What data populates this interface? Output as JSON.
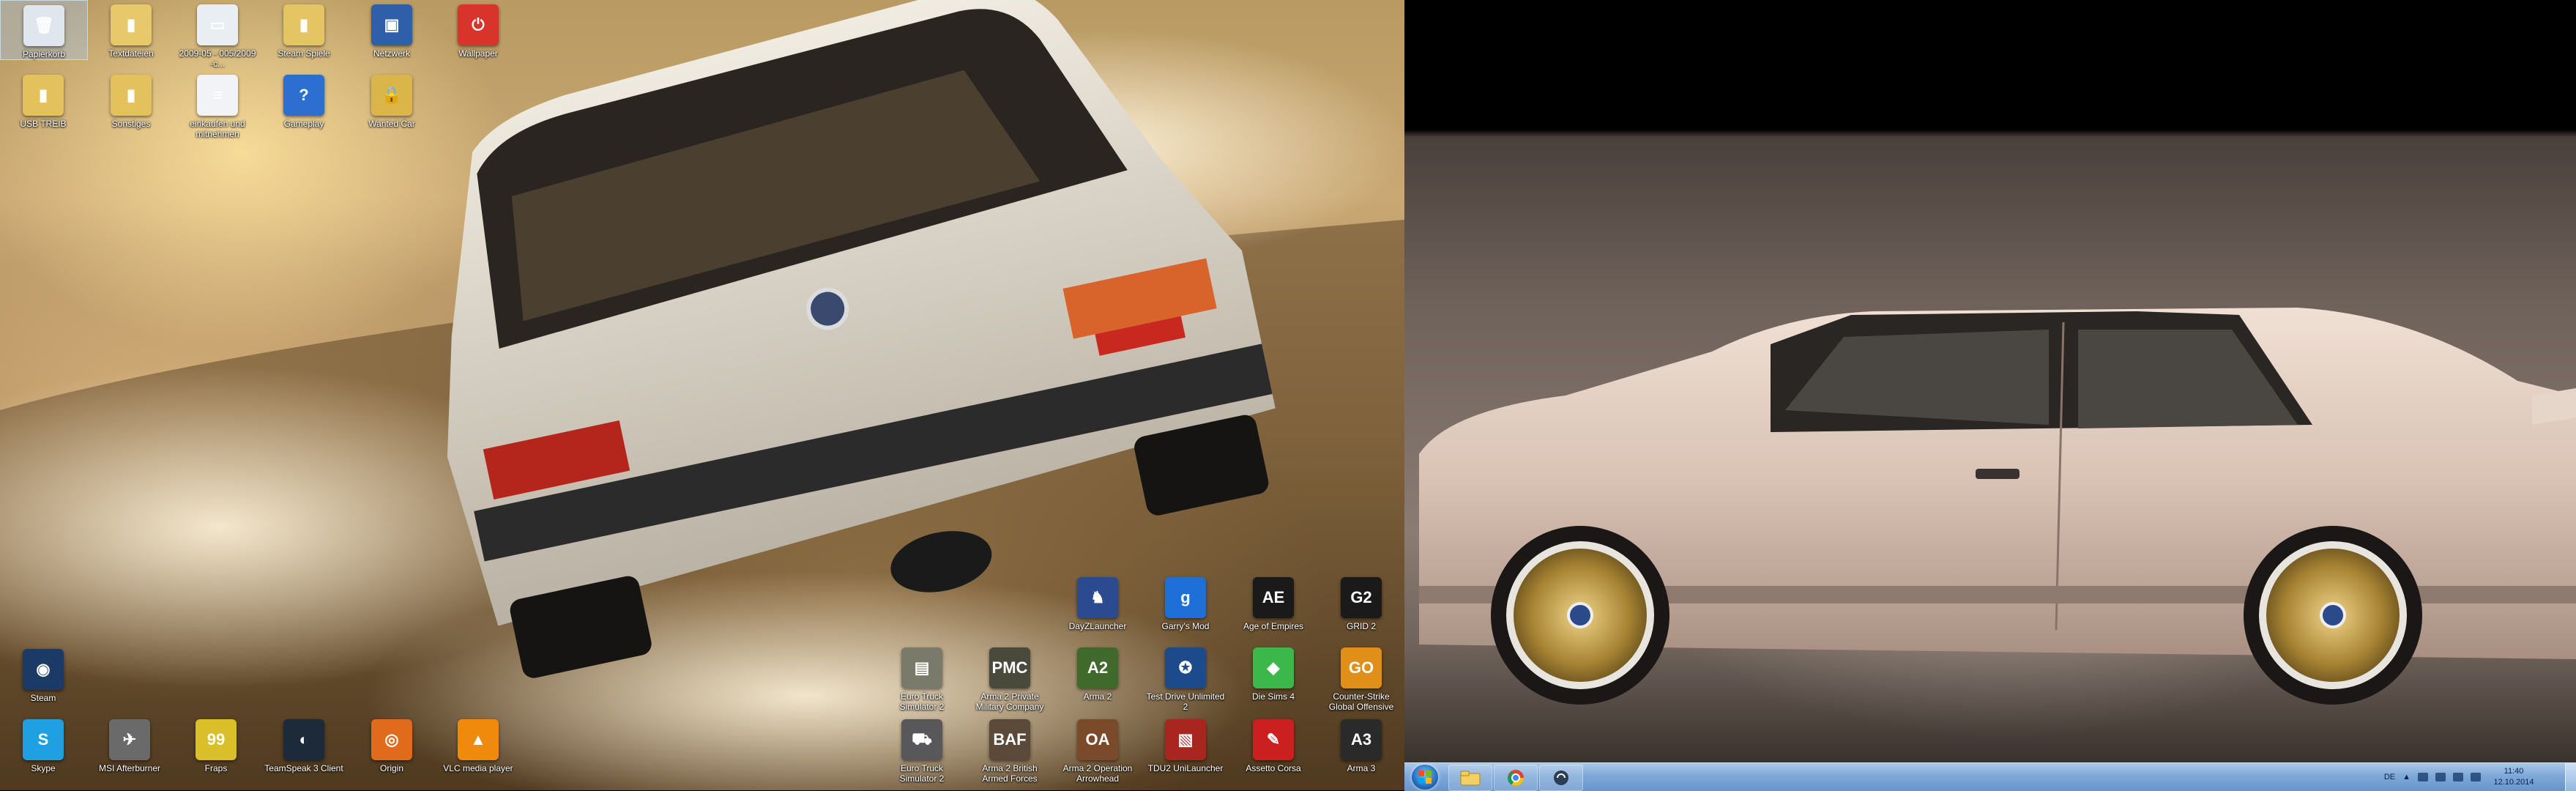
{
  "desktop_top": [
    {
      "name": "recycle-bin-icon",
      "label": "Papierkorb",
      "color": "#dfe6ee",
      "glyph": "🗑",
      "selected": true
    },
    {
      "name": "folder-icon",
      "label": "Textdateien",
      "color": "#e7c96b",
      "glyph": "▮"
    },
    {
      "name": "image-file-icon",
      "label": "2009-05 - 005/2009 -c...",
      "color": "#e9eef3",
      "glyph": "▭"
    },
    {
      "name": "steam-folder-icon",
      "label": "Steam Spiele",
      "color": "#e5c463",
      "glyph": "▮"
    },
    {
      "name": "network-icon",
      "label": "Netzwerk",
      "color": "#2f5fa8",
      "glyph": "▣"
    },
    {
      "name": "wallpaper-icon",
      "label": "Wallpaper",
      "color": "#d9342b",
      "glyph": "⏻"
    },
    {
      "name": "folder-icon",
      "label": "USB TREIB",
      "color": "#e3c25e",
      "glyph": "▮"
    },
    {
      "name": "folder-icon",
      "label": "Sonstiges",
      "color": "#e3c25e",
      "glyph": "▮"
    },
    {
      "name": "document-icon",
      "label": "einkaufen und mitnehmen",
      "color": "#f1f3f6",
      "glyph": "≡"
    },
    {
      "name": "help-icon",
      "label": "Gameplay",
      "color": "#2c6fd1",
      "glyph": "?"
    },
    {
      "name": "lock-folder-icon",
      "label": "Wanted Car",
      "color": "#d9b54a",
      "glyph": "🔒"
    }
  ],
  "desktop_left": [
    {
      "name": "steam-icon",
      "label": "Steam",
      "color": "#1b3b66",
      "glyph": "◉"
    },
    {
      "name": "skype-icon",
      "label": "Skype",
      "color": "#1fa0e3",
      "glyph": "S"
    },
    {
      "name": "afterburner-icon",
      "label": "MSI Afterburner",
      "color": "#6a6a6a",
      "glyph": "✈"
    },
    {
      "name": "fraps-icon",
      "label": "Fraps",
      "color": "#d9c02a",
      "glyph": "99"
    },
    {
      "name": "teamspeak-icon",
      "label": "TeamSpeak 3 Client",
      "color": "#1d2a3a",
      "glyph": "◐"
    },
    {
      "name": "origin-icon",
      "label": "Origin",
      "color": "#e06b1d",
      "glyph": "◎"
    },
    {
      "name": "vlc-icon",
      "label": "VLC media player",
      "color": "#f08a0c",
      "glyph": "▲"
    }
  ],
  "desktop_games": [
    {
      "name": "dayz-launcher-icon",
      "label": "DayZLauncher",
      "color": "#2b4a8f",
      "glyph": "♞"
    },
    {
      "name": "garrys-mod-icon",
      "label": "Garry's Mod",
      "color": "#1e6fd8",
      "glyph": "g"
    },
    {
      "name": "age-of-empires-icon",
      "label": "Age of Empires",
      "color": "#1a1a1a",
      "glyph": "AE"
    },
    {
      "name": "grid-icon",
      "label": "GRID 2",
      "color": "#1a1a1a",
      "glyph": "G2"
    },
    {
      "name": "euro-truck-icon",
      "label": "Euro Truck Simulator 2",
      "color": "#7a7a6a",
      "glyph": "▤"
    },
    {
      "name": "arma2-pmc-icon",
      "label": "Arma 2 Private Military Company",
      "color": "#4a4a3c",
      "glyph": "PMC"
    },
    {
      "name": "arma2-icon",
      "label": "Arma 2",
      "color": "#3f6a2c",
      "glyph": "A2"
    },
    {
      "name": "tdu2-icon",
      "label": "Test Drive Unlimited 2",
      "color": "#1d4a8a",
      "glyph": "✪"
    },
    {
      "name": "sims4-icon",
      "label": "Die Sims 4",
      "color": "#3cb84a",
      "glyph": "◆"
    },
    {
      "name": "csgo-icon",
      "label": "Counter-Strike Global Offensive",
      "color": "#e08f18",
      "glyph": "GO"
    },
    {
      "name": "euro-truck-icon",
      "label": "Euro Truck Simulator 2",
      "color": "#58585a",
      "glyph": "⛟"
    },
    {
      "name": "arma2-baf-icon",
      "label": "Arma 2 British Armed Forces",
      "color": "#5b4a3a",
      "glyph": "BAF"
    },
    {
      "name": "arma2-oa-icon",
      "label": "Arma 2 Operation Arrowhead",
      "color": "#7a4a2a",
      "glyph": "OA"
    },
    {
      "name": "tdu2-unilauncher-icon",
      "label": "TDU2 UniLauncher",
      "color": "#a8261f",
      "glyph": "▧"
    },
    {
      "name": "assetto-corsa-icon",
      "label": "Assetto Corsa",
      "color": "#cc1f1f",
      "glyph": "✎"
    },
    {
      "name": "arma3-icon",
      "label": "Arma 3",
      "color": "#2a2a2a",
      "glyph": "A3"
    }
  ],
  "taskbar": {
    "language": "DE",
    "time": "11:40",
    "date": "12.10.2014"
  }
}
